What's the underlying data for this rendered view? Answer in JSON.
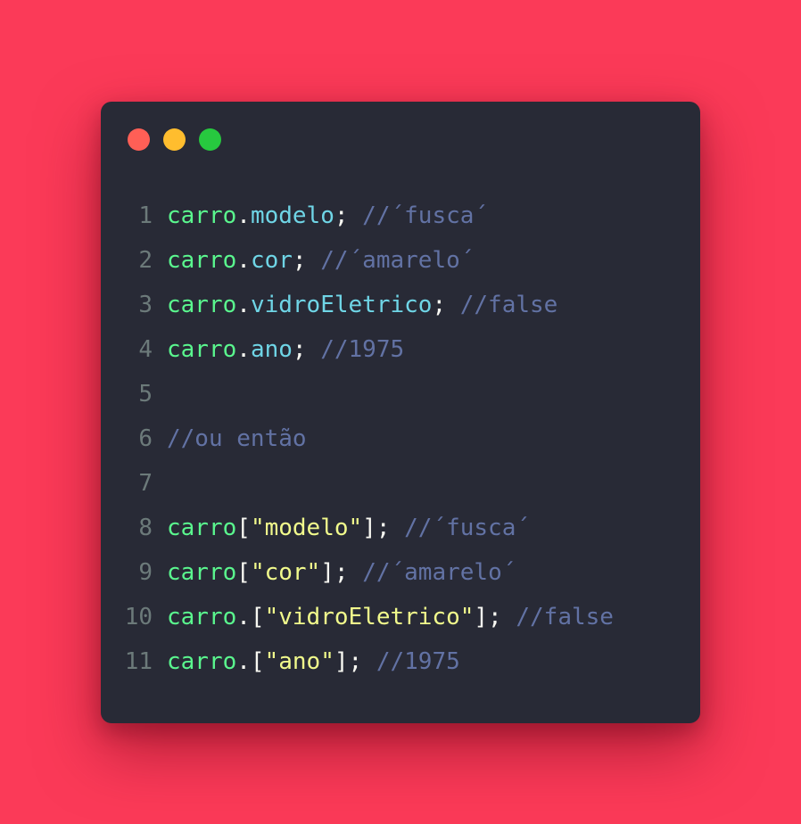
{
  "colors": {
    "background": "#fb3a58",
    "window": "#282a36",
    "dot_close": "#ff5f56",
    "dot_minimize": "#ffbd2e",
    "dot_zoom": "#27c93f"
  },
  "window_dots": [
    {
      "name": "close-dot-icon",
      "color": "#ff5f56"
    },
    {
      "name": "minimize-dot-icon",
      "color": "#ffbd2e"
    },
    {
      "name": "zoom-dot-icon",
      "color": "#27c93f"
    }
  ],
  "code_lines": [
    {
      "number": "1",
      "tokens": [
        {
          "t": "obj",
          "text": "carro"
        },
        {
          "t": "punc",
          "text": "."
        },
        {
          "t": "prop",
          "text": "modelo"
        },
        {
          "t": "punc",
          "text": "; "
        },
        {
          "t": "com",
          "text": "//´fusca´"
        }
      ]
    },
    {
      "number": "2",
      "tokens": [
        {
          "t": "obj",
          "text": "carro"
        },
        {
          "t": "punc",
          "text": "."
        },
        {
          "t": "prop",
          "text": "cor"
        },
        {
          "t": "punc",
          "text": "; "
        },
        {
          "t": "com",
          "text": "//´amarelo´"
        }
      ]
    },
    {
      "number": "3",
      "tokens": [
        {
          "t": "obj",
          "text": "carro"
        },
        {
          "t": "punc",
          "text": "."
        },
        {
          "t": "prop",
          "text": "vidroEletrico"
        },
        {
          "t": "punc",
          "text": "; "
        },
        {
          "t": "com",
          "text": "//false"
        }
      ]
    },
    {
      "number": "4",
      "tokens": [
        {
          "t": "obj",
          "text": "carro"
        },
        {
          "t": "punc",
          "text": "."
        },
        {
          "t": "prop",
          "text": "ano"
        },
        {
          "t": "punc",
          "text": "; "
        },
        {
          "t": "com",
          "text": "//1975"
        }
      ]
    },
    {
      "number": "5",
      "tokens": []
    },
    {
      "number": "6",
      "tokens": [
        {
          "t": "com",
          "text": "//ou então"
        }
      ]
    },
    {
      "number": "7",
      "tokens": []
    },
    {
      "number": "8",
      "tokens": [
        {
          "t": "obj",
          "text": "carro"
        },
        {
          "t": "punc",
          "text": "["
        },
        {
          "t": "str",
          "text": "\"modelo\""
        },
        {
          "t": "punc",
          "text": "]; "
        },
        {
          "t": "com",
          "text": "//´fusca´"
        }
      ]
    },
    {
      "number": "9",
      "tokens": [
        {
          "t": "obj",
          "text": "carro"
        },
        {
          "t": "punc",
          "text": "["
        },
        {
          "t": "str",
          "text": "\"cor\""
        },
        {
          "t": "punc",
          "text": "]; "
        },
        {
          "t": "com",
          "text": "//´amarelo´"
        }
      ]
    },
    {
      "number": "10",
      "tokens": [
        {
          "t": "obj",
          "text": "carro"
        },
        {
          "t": "punc",
          "text": ".["
        },
        {
          "t": "str",
          "text": "\"vidroEletrico\""
        },
        {
          "t": "punc",
          "text": "]; "
        },
        {
          "t": "com",
          "text": "//false"
        }
      ]
    },
    {
      "number": "11",
      "tokens": [
        {
          "t": "obj",
          "text": "carro"
        },
        {
          "t": "punc",
          "text": ".["
        },
        {
          "t": "str",
          "text": "\"ano\""
        },
        {
          "t": "punc",
          "text": "]; "
        },
        {
          "t": "com",
          "text": "//1975"
        }
      ]
    }
  ]
}
